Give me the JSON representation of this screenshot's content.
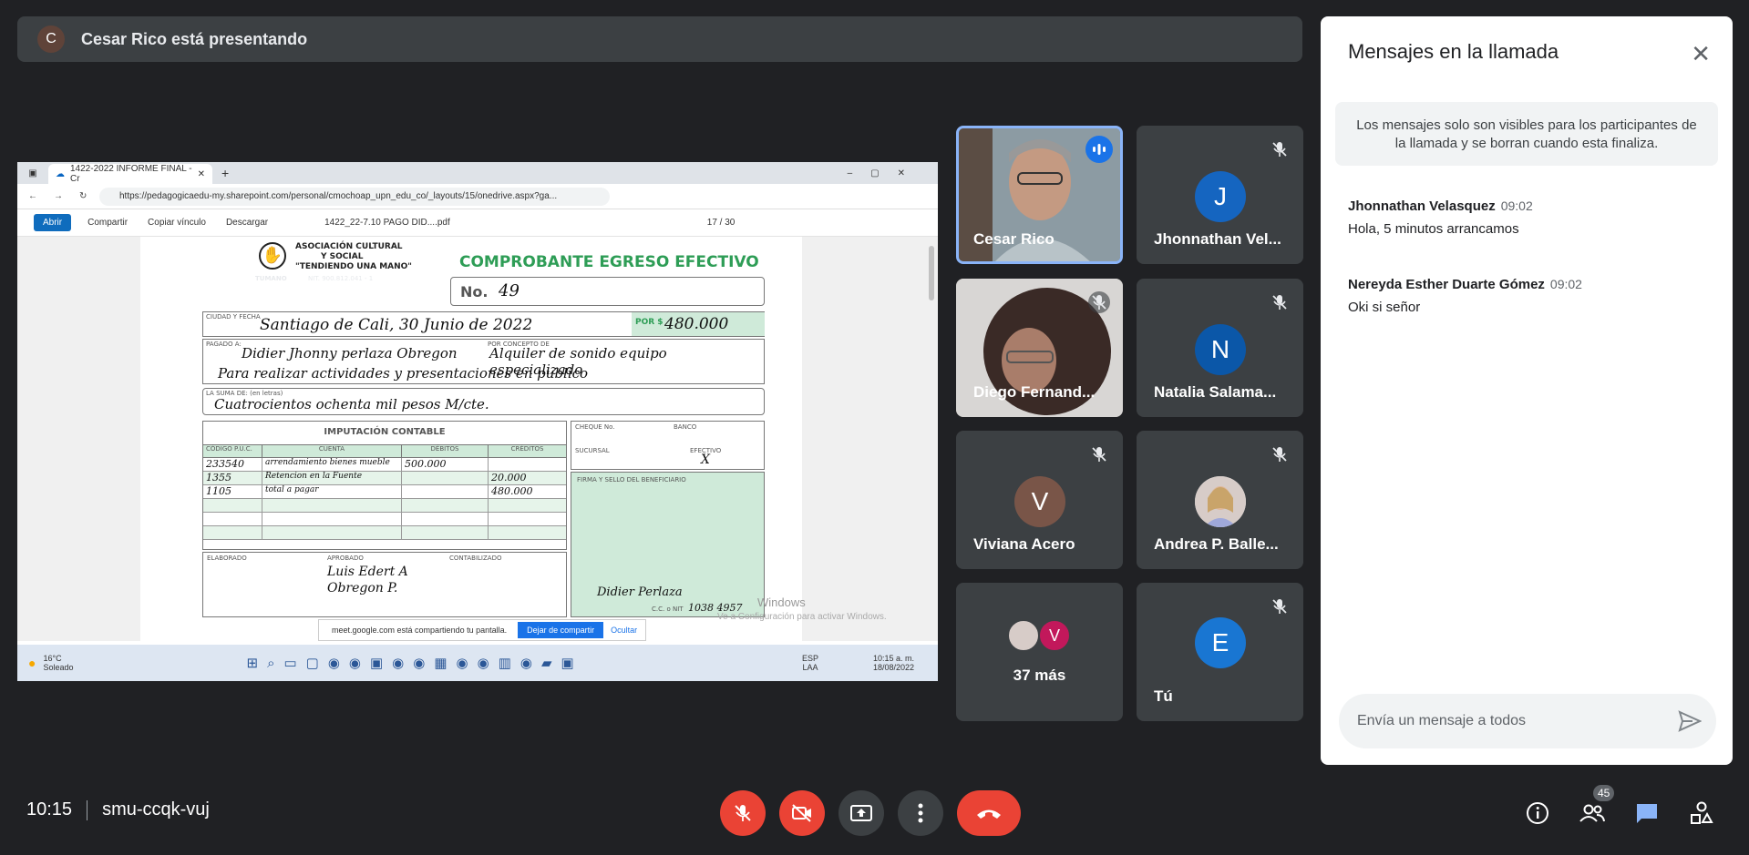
{
  "presenting": {
    "avatar_letter": "C",
    "text": "Cesar Rico está presentando"
  },
  "shared_screen": {
    "browser_tab": "1422-2022 INFORME FINAL - Cr",
    "url": "https://pedagogicaedu-my.sharepoint.com/personal/cmochoap_upn_edu_co/_layouts/15/onedrive.aspx?ga...",
    "toolbar": {
      "open": "Abrir",
      "share": "Compartir",
      "copy_link": "Copiar vínculo",
      "download": "Descargar",
      "file": "1422_22-7.10 PAGO DID....pdf",
      "page": "17 / 30"
    },
    "doc": {
      "org_line1": "ASOCIACIÓN CULTURAL",
      "org_line2": "Y SOCIAL",
      "org_line3": "\"TENDIENDO UNA MANO\"",
      "org_city": "TUMANO",
      "org_nit": "NIT. 900.812.041 - 1",
      "title": "COMPROBANTE EGRESO EFECTIVO",
      "number_label": "No.",
      "number": "49",
      "city_date_label": "CIUDAD Y FECHA",
      "city_date": "Santiago de Cali, 30 Junio de 2022",
      "por_label": "POR $",
      "amount": "480.000",
      "paid_to_label": "PAGADO A:",
      "paid_to": "Didier Jhonny perlaza Obregon",
      "concept_label": "POR CONCEPTO DE",
      "concept": "Alquiler de sonido equipo especializado",
      "concept2": "Para realizar actividades y presentaciones en publico",
      "sum_label": "LA SUMA DE: (en letras)",
      "sum_words": "Cuatrocientos ochenta mil pesos M/cte.",
      "imputacion": "IMPUTACIÓN CONTABLE",
      "col_code": "CÓDIGO P.U.C.",
      "col_account": "CUENTA",
      "col_debit": "DÉBITOS",
      "col_credit": "CRÉDITOS",
      "rows": [
        {
          "code": "233540",
          "account": "arrendamiento bienes mueble",
          "debit": "500.000",
          "credit": ""
        },
        {
          "code": "1355",
          "account": "Retencion en la Fuente",
          "debit": "",
          "credit": "20.000"
        },
        {
          "code": "1105",
          "account": "total a pagar",
          "debit": "",
          "credit": "480.000"
        }
      ],
      "cheque_label": "CHEQUE No.",
      "banco_label": "BANCO",
      "sucursal_label": "SUCURSAL",
      "efectivo_label": "EFECTIVO",
      "efectivo_mark": "X",
      "firma_label": "FIRMA Y SELLO DEL BENEFICIARIO",
      "elaborado_label": "ELABORADO",
      "aprobado_label": "APROBADO",
      "aprobado_sig": "Luis Edert A Obregon P.",
      "contabilizado_label": "CONTABILIZADO",
      "beneficiary_sig": "Didier Perlaza",
      "cc_label": "C.C. o NIT",
      "cc": "1038 4957",
      "watermark1": "Windows",
      "watermark2": "Ve a Configuración para activar Windows."
    },
    "share_bar": {
      "text": "meet.google.com está compartiendo tu pantalla.",
      "stop": "Dejar de compartir",
      "hide": "Ocultar"
    },
    "taskbar": {
      "weather_temp": "16°C",
      "weather_desc": "Soleado",
      "lang1": "ESP",
      "lang2": "LAA",
      "time": "10:15 a. m.",
      "date": "18/08/2022"
    }
  },
  "participants": [
    {
      "name": "Cesar Rico",
      "type": "video",
      "speaking": true
    },
    {
      "name": "Jhonnathan Vel...",
      "letter": "J",
      "color": "#1565c0",
      "muted": true
    },
    {
      "name": "Diego Fernand...",
      "type": "video",
      "muted": true
    },
    {
      "name": "Natalia Salama...",
      "letter": "N",
      "color": "#0b57a8",
      "muted": true
    },
    {
      "name": "Viviana Acero",
      "letter": "V",
      "color": "#795548",
      "muted": true
    },
    {
      "name": "Andrea P. Balle...",
      "type": "photo",
      "muted": true
    },
    {
      "name": "37 más",
      "type": "more",
      "letter": "V"
    },
    {
      "name": "Tú",
      "letter": "E",
      "color": "#1976d2",
      "muted": true
    }
  ],
  "chat": {
    "title": "Mensajes en la llamada",
    "notice": "Los mensajes solo son visibles para los participantes de la llamada y se borran cuando esta finaliza.",
    "messages": [
      {
        "sender": "Jhonnathan Velasquez",
        "time": "09:02",
        "text": "Hola, 5 minutos arrancamos"
      },
      {
        "sender": "Nereyda Esther Duarte Gómez",
        "time": "09:02",
        "text": "Oki si señor"
      }
    ],
    "input_placeholder": "Envía un mensaje a todos"
  },
  "bottom": {
    "time": "10:15",
    "meeting_code": "smu-ccqk-vuj",
    "people_count": "45"
  },
  "colors": {
    "bg": "#202124",
    "tile": "#3c4043",
    "red": "#ea4335",
    "accent": "#8ab4f8",
    "chat_icon": "#8ab4f8"
  }
}
